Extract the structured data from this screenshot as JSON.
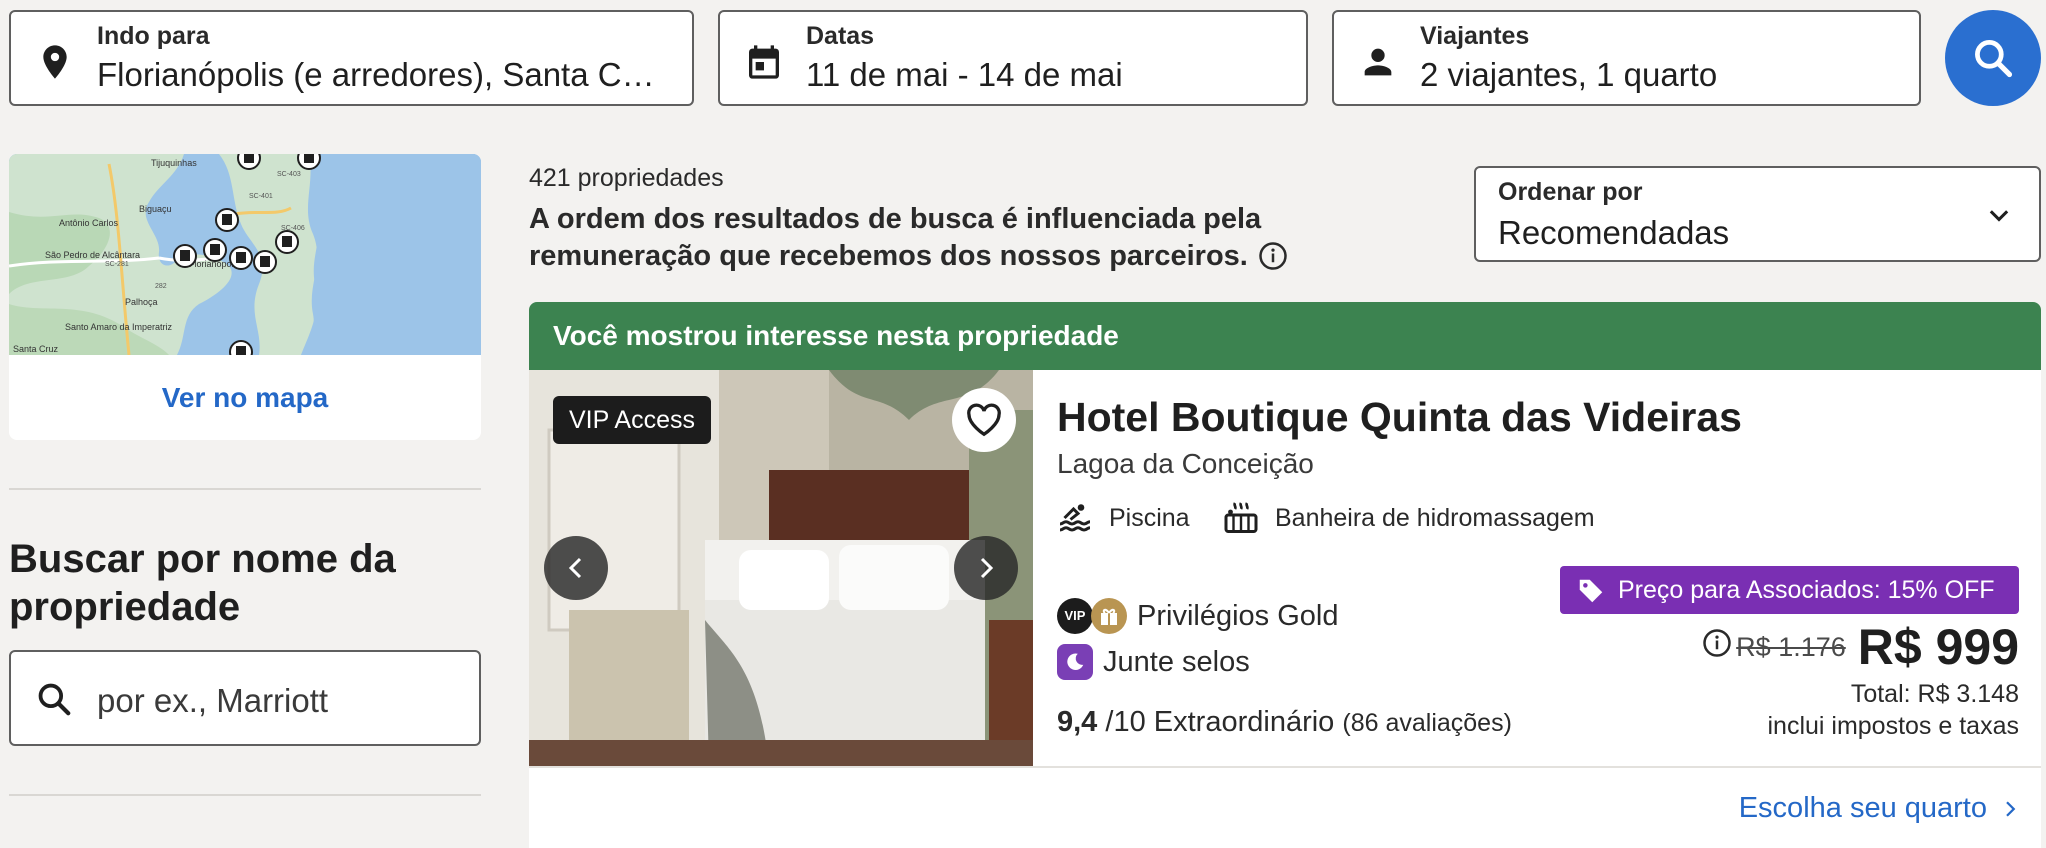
{
  "search": {
    "destination": {
      "label": "Indo para",
      "value": "Florianópolis (e arredores), Santa Catarina, Brasil"
    },
    "dates": {
      "label": "Datas",
      "value": "11 de mai - 14 de mai"
    },
    "travelers": {
      "label": "Viajantes",
      "value": "2 viajantes, 1 quarto"
    }
  },
  "map": {
    "link_label": "Ver no mapa",
    "places": [
      "Tijuquinhas",
      "Biguaçu",
      "Antônio Carlos",
      "São Pedro de Alcântara",
      "Florianópolis",
      "Palhoça",
      "Santo Amaro da Imperatriz",
      "Santa Cruz"
    ],
    "roads": [
      "SC-401",
      "SC-403",
      "SC-406",
      "SC-281",
      "282"
    ]
  },
  "name_search": {
    "heading": "Buscar por nome da propriedade",
    "placeholder": "por ex., Marriott"
  },
  "results": {
    "count": "421 propriedades",
    "disclaimer": "A ordem dos resultados de busca é influenciada pela remuneração que recebemos dos nossos parceiros."
  },
  "sort": {
    "label": "Ordenar por",
    "value": "Recomendadas"
  },
  "property": {
    "banner": "Você mostrou interesse nesta propriedade",
    "vip_tag": "VIP Access",
    "name": "Hotel Boutique Quinta das Videiras",
    "area": "Lagoa da Conceição",
    "amenities": [
      "Piscina",
      "Banheira de hidromassagem"
    ],
    "vip_badge": "VIP",
    "privileges": "Privilégios Gold",
    "stamps": "Junte selos",
    "rating_score": "9,4",
    "rating_scale": "/10",
    "rating_word": "Extraordinário",
    "reviews": "(86 avaliações)",
    "promo": "Preço para Associados: 15% OFF",
    "old_price": "R$ 1.176",
    "price": "R$ 999",
    "total": "Total: R$ 3.148",
    "taxes": "inclui impostos e taxas",
    "choose_room": "Escolha seu quarto"
  },
  "colors": {
    "primary_blue": "#2a6fd0",
    "link_blue": "#2468c7",
    "banner_green": "#3c8350",
    "promo_purple": "#7a2fb3",
    "background": "#f3f2f0"
  },
  "icons": [
    "location-pin-icon",
    "calendar-icon",
    "person-icon",
    "search-icon",
    "hotel-marker-icon",
    "info-icon",
    "chevron-down-icon",
    "heart-icon",
    "chevron-left-icon",
    "chevron-right-icon",
    "pool-icon",
    "hot-tub-icon",
    "gift-icon",
    "moon-icon",
    "tag-icon"
  ]
}
